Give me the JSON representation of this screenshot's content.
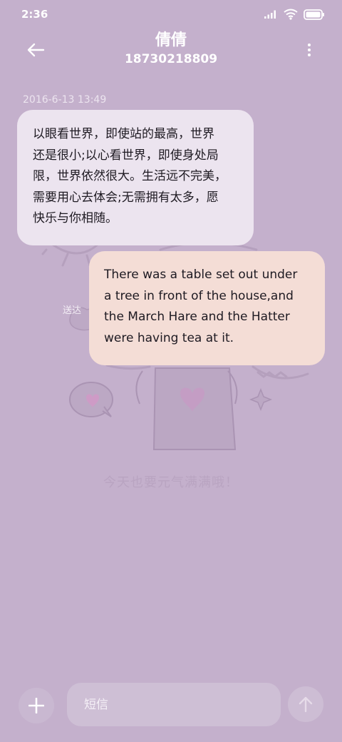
{
  "status_bar": {
    "time": "2:36",
    "icons": [
      "signal-icon",
      "wifi-icon",
      "battery-icon"
    ]
  },
  "header": {
    "contact_name": "倩倩",
    "phone_number": "18730218809",
    "back_icon": "back-arrow-icon",
    "more_icon": "more-vertical-icon"
  },
  "conversation": {
    "timestamp": "2016-6-13 13:49",
    "messages": [
      {
        "direction": "incoming",
        "lines": [
          "以眼看世界，即使站的最高，世界",
          "还是很小;以心看世界，即使身处局",
          "限，世界依然很大。生活远不完美，",
          "需要用心去体会;无需拥有太多，愿",
          "快乐与你相随。"
        ]
      },
      {
        "direction": "outgoing",
        "lines": [
          "There was a table set out under",
          "a tree in front of the house,and",
          "the March Hare and the Hatter",
          "were having tea at it."
        ],
        "status": "送达"
      }
    ]
  },
  "wallpaper": {
    "caption": "今天也要元气满满哦！"
  },
  "composer": {
    "placeholder": "短信",
    "add_icon": "plus-icon",
    "send_icon": "send-arrow-up-icon"
  },
  "colors": {
    "background": "#c4b0cc",
    "incoming_bubble": "#ece4ef",
    "outgoing_bubble": "#f4ddd6"
  }
}
